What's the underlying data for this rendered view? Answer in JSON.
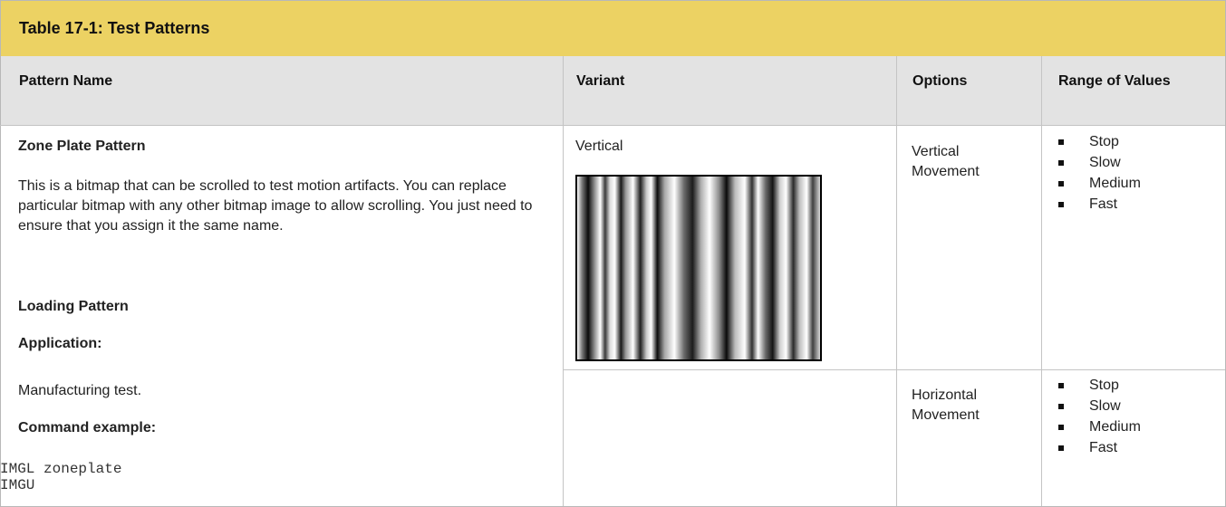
{
  "table": {
    "title": "Table 17-1: Test Patterns",
    "headers": {
      "pattern_name": "Pattern Name",
      "variant": "Variant",
      "options": "Options",
      "range": "Range of Values"
    }
  },
  "pattern": {
    "name": "Zone Plate Pattern",
    "description": "This is a bitmap that can be scrolled to test motion artifacts. You can replace particular bitmap with any other bitmap image to allow scrolling. You just need to ensure that you assign it the same name.",
    "loading_heading": "Loading Pattern",
    "application_heading": "Application:",
    "application_text": "Manufacturing test.",
    "command_heading": "Command example:",
    "command_lines": [
      "IMGL zoneplate",
      "IMGU"
    ]
  },
  "rows": [
    {
      "variant": "Vertical",
      "option_line1": "Vertical",
      "option_line2": "Movement",
      "values": [
        "Stop",
        "Slow",
        "Medium",
        "Fast"
      ]
    },
    {
      "variant": "",
      "option_line1": "Horizontal",
      "option_line2": "Movement",
      "values": [
        "Stop",
        "Slow",
        "Medium",
        "Fast"
      ]
    }
  ],
  "colors": {
    "title_bar": "#ecd263",
    "header_row": "#e3e3e3",
    "grid": "#c4c4c4"
  }
}
